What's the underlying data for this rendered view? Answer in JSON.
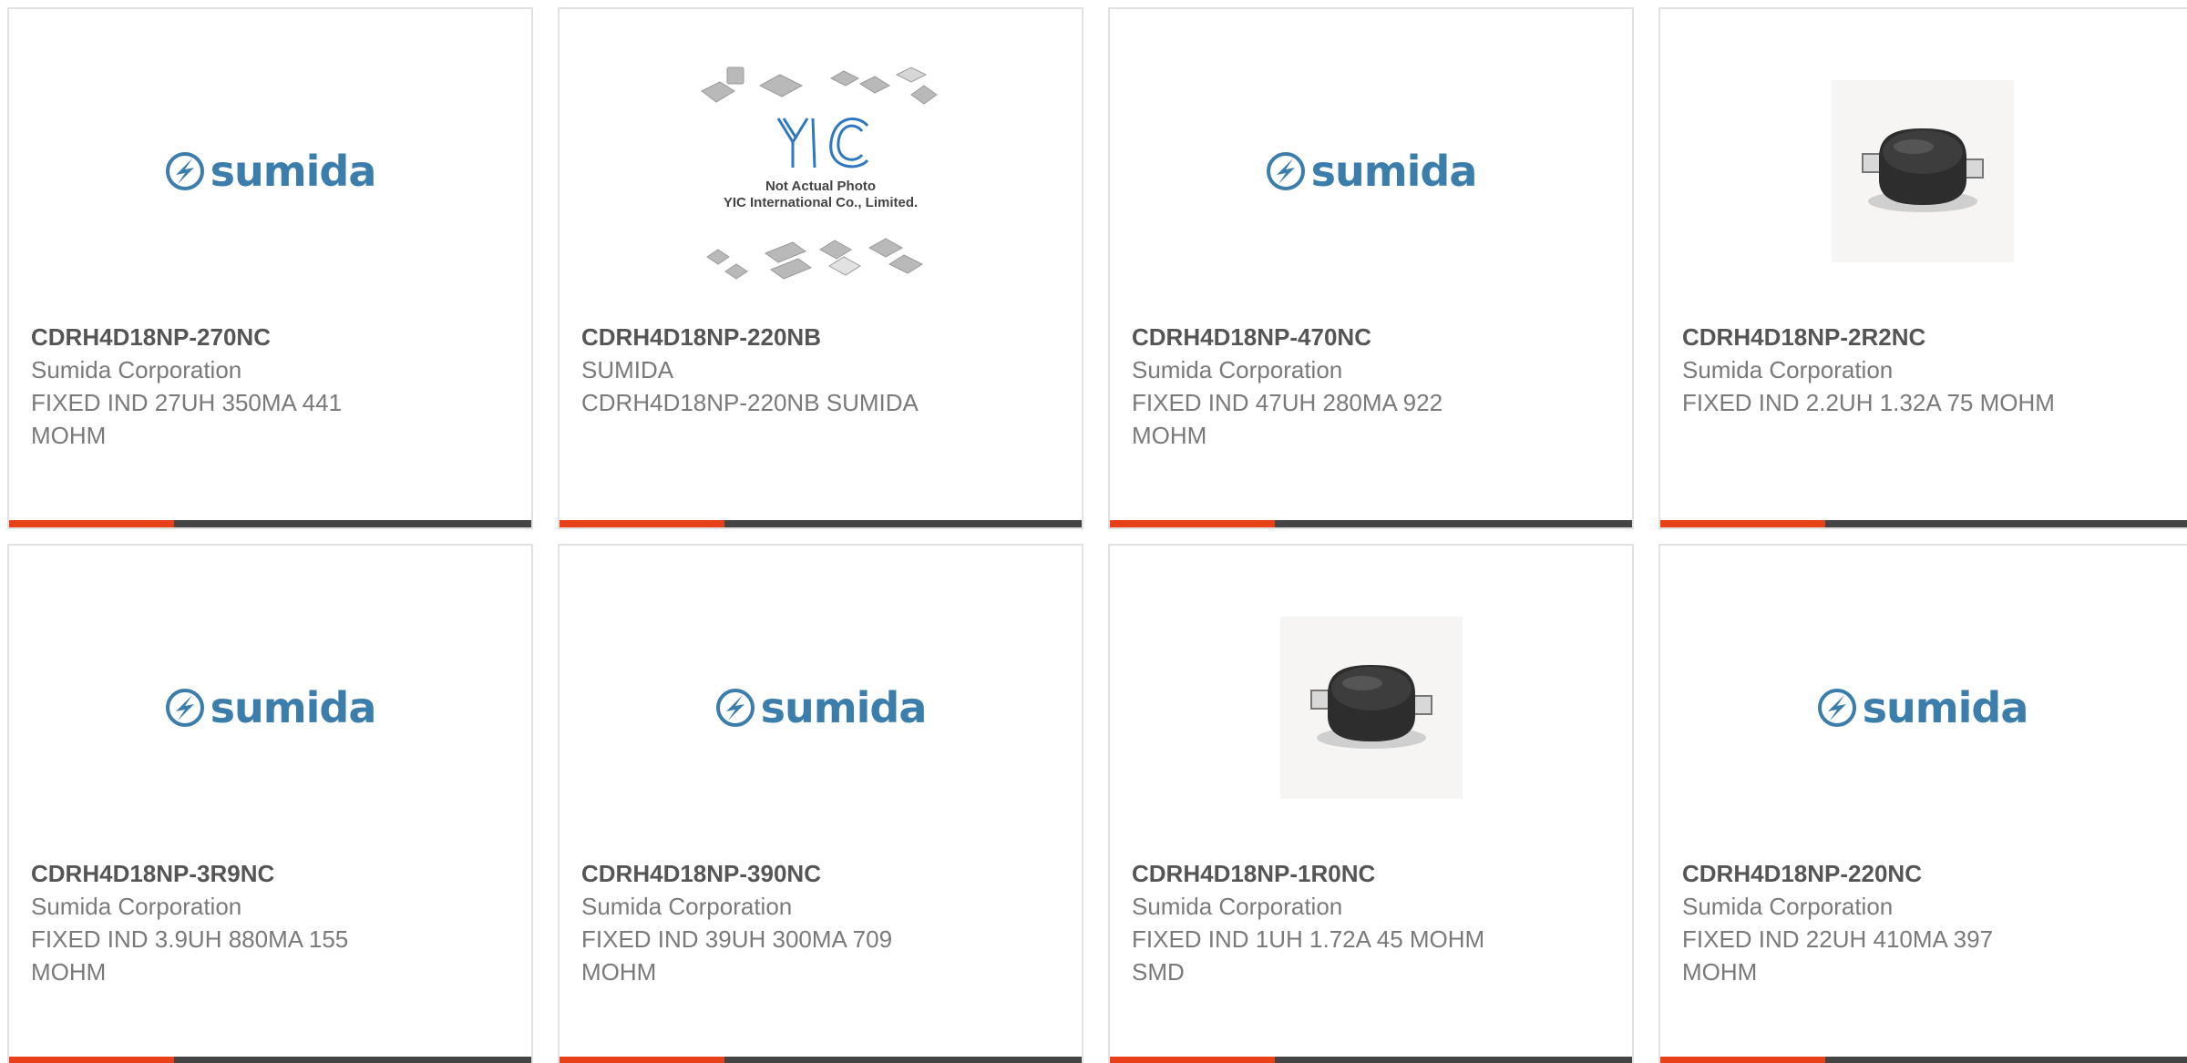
{
  "colors": {
    "accent": "#e8411a",
    "bar": "#444444",
    "brand_blue": "#3b7dab",
    "title_text": "#555555",
    "body_text": "#7a7a7a"
  },
  "yic_placeholder": {
    "brand": "YIC",
    "line1": "Not Actual Photo",
    "line2": "YIC International Co., Limited."
  },
  "products": [
    {
      "part_number": "CDRH4D18NP-270NC",
      "manufacturer": "Sumida Corporation",
      "description": "FIXED IND 27UH 350MA 441 MOHM",
      "image": "sumida-logo"
    },
    {
      "part_number": "CDRH4D18NP-220NB",
      "manufacturer": "SUMIDA",
      "description": "CDRH4D18NP-220NB SUMIDA",
      "image": "yic-placeholder"
    },
    {
      "part_number": "CDRH4D18NP-470NC",
      "manufacturer": "Sumida Corporation",
      "description": "FIXED IND 47UH 280MA 922 MOHM",
      "image": "sumida-logo"
    },
    {
      "part_number": "CDRH4D18NP-2R2NC",
      "manufacturer": "Sumida Corporation",
      "description": "FIXED IND 2.2UH 1.32A 75 MOHM",
      "image": "inductor-photo"
    },
    {
      "part_number": "CDRH4D18NP-3R9NC",
      "manufacturer": "Sumida Corporation",
      "description": "FIXED IND 3.9UH 880MA 155 MOHM",
      "image": "sumida-logo"
    },
    {
      "part_number": "CDRH4D18NP-390NC",
      "manufacturer": "Sumida Corporation",
      "description": "FIXED IND 39UH 300MA 709 MOHM",
      "image": "sumida-logo"
    },
    {
      "part_number": "CDRH4D18NP-1R0NC",
      "manufacturer": "Sumida Corporation",
      "description": "FIXED IND 1UH 1.72A 45 MOHM SMD",
      "image": "inductor-photo"
    },
    {
      "part_number": "CDRH4D18NP-220NC",
      "manufacturer": "Sumida Corporation",
      "description": "FIXED IND 22UH 410MA 397 MOHM",
      "image": "sumida-logo"
    }
  ],
  "sumida_logo_text": "sumida"
}
